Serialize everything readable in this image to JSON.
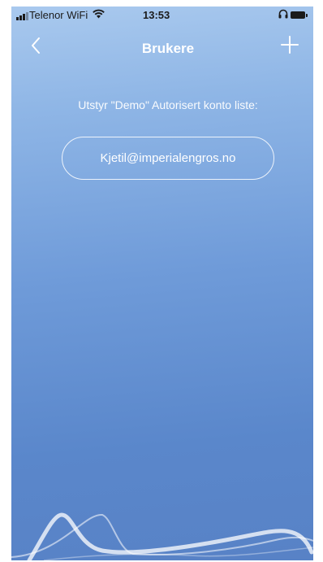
{
  "status_bar": {
    "carrier": "Telenor WiFi",
    "time": "13:53",
    "icons": [
      "signal-icon",
      "wifi-icon",
      "headphones-icon",
      "battery-icon"
    ]
  },
  "nav": {
    "title": "Brukere",
    "back_icon": "chevron-left-icon",
    "add_icon": "plus-icon"
  },
  "content": {
    "subtitle": "Utstyr \"Demo\" Autorisert konto liste:",
    "accounts": [
      "Kjetil@imperialengros.no"
    ]
  },
  "colors": {
    "gradient_top": "#a9c9ee",
    "gradient_bottom": "#5882c6",
    "text": "#ffffff"
  }
}
